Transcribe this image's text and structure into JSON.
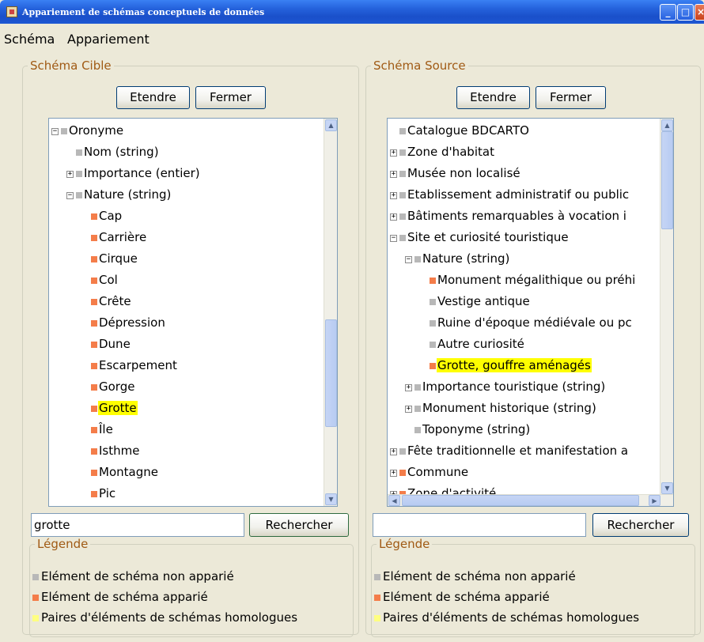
{
  "window": {
    "title": "Appariement de schémas conceptuels de données"
  },
  "menu": [
    "Schéma",
    "Appariement"
  ],
  "target": {
    "title": "Schéma Cible",
    "expand_label": "Etendre",
    "close_label": "Fermer",
    "tree": [
      {
        "label": "Oronyme",
        "square": "gray",
        "expander": "minus",
        "highlight": false
      },
      {
        "label": "Nom (string)",
        "square": "gray",
        "expander": null,
        "highlight": false
      },
      {
        "label": "Importance (entier)",
        "square": "gray",
        "expander": "plus",
        "highlight": false
      },
      {
        "label": "Nature (string)",
        "square": "gray",
        "expander": "minus",
        "highlight": false
      },
      {
        "label": "Cap",
        "square": "orange",
        "expander": null,
        "highlight": false
      },
      {
        "label": "Carrière",
        "square": "orange",
        "expander": null,
        "highlight": false
      },
      {
        "label": "Cirque",
        "square": "orange",
        "expander": null,
        "highlight": false
      },
      {
        "label": "Col",
        "square": "orange",
        "expander": null,
        "highlight": false
      },
      {
        "label": "Crête",
        "square": "orange",
        "expander": null,
        "highlight": false
      },
      {
        "label": "Dépression",
        "square": "orange",
        "expander": null,
        "highlight": false
      },
      {
        "label": "Dune",
        "square": "orange",
        "expander": null,
        "highlight": false
      },
      {
        "label": "Escarpement",
        "square": "orange",
        "expander": null,
        "highlight": false
      },
      {
        "label": "Gorge",
        "square": "orange",
        "expander": null,
        "highlight": false
      },
      {
        "label": "Grotte",
        "square": "orange",
        "expander": null,
        "highlight": true
      },
      {
        "label": "Île",
        "square": "orange",
        "expander": null,
        "highlight": false
      },
      {
        "label": "Isthme",
        "square": "orange",
        "expander": null,
        "highlight": false
      },
      {
        "label": "Montagne",
        "square": "orange",
        "expander": null,
        "highlight": false
      },
      {
        "label": "Pic",
        "square": "orange",
        "expander": null,
        "highlight": false
      }
    ],
    "search_value": "grotte",
    "search_button": "Rechercher"
  },
  "source": {
    "title": "Schéma Source",
    "expand_label": "Etendre",
    "close_label": "Fermer",
    "tree": [
      {
        "label": "Catalogue BDCARTO",
        "square": "gray",
        "expander": null,
        "highlight": false
      },
      {
        "label": "Zone d'habitat",
        "square": "gray",
        "expander": "plus",
        "highlight": false
      },
      {
        "label": "Musée non localisé",
        "square": "gray",
        "expander": "plus",
        "highlight": false
      },
      {
        "label": "Etablissement administratif ou public",
        "square": "gray",
        "expander": "plus",
        "highlight": false
      },
      {
        "label": "Bâtiments remarquables à vocation i",
        "square": "gray",
        "expander": "plus",
        "highlight": false
      },
      {
        "label": "Site et curiosité touristique",
        "square": "gray",
        "expander": "minus",
        "highlight": false
      },
      {
        "label": "Nature (string)",
        "square": "gray",
        "expander": "minus",
        "highlight": false
      },
      {
        "label": "Monument mégalithique ou préhi",
        "square": "orange",
        "expander": null,
        "highlight": false
      },
      {
        "label": "Vestige antique",
        "square": "gray",
        "expander": null,
        "highlight": false
      },
      {
        "label": "Ruine d'époque médiévale ou pc",
        "square": "gray",
        "expander": null,
        "highlight": false
      },
      {
        "label": "Autre curiosité",
        "square": "gray",
        "expander": null,
        "highlight": false
      },
      {
        "label": "Grotte, gouffre aménagés",
        "square": "orange",
        "expander": null,
        "highlight": true
      },
      {
        "label": "Importance touristique (string)",
        "square": "gray",
        "expander": "plus",
        "highlight": false
      },
      {
        "label": "Monument historique (string)",
        "square": "gray",
        "expander": "plus",
        "highlight": false
      },
      {
        "label": "Toponyme (string)",
        "square": "gray",
        "expander": null,
        "highlight": false
      },
      {
        "label": "Fête traditionnelle et manifestation a",
        "square": "gray",
        "expander": "plus",
        "highlight": false
      },
      {
        "label": "Commune",
        "square": "orange",
        "expander": "plus",
        "highlight": false
      },
      {
        "label": "Zone d'activité",
        "square": "orange",
        "expander": "plus",
        "highlight": false
      }
    ],
    "search_value": "",
    "search_button": "Rechercher"
  },
  "legend": {
    "title": "Légende",
    "items": [
      {
        "label": "Elément de schéma non apparié",
        "color": "#b8b8b8"
      },
      {
        "label": "Elément de schéma apparié",
        "color": "#f47d4a"
      },
      {
        "label": "Paires d'éléments de schémas homologues",
        "color": "#ffff80"
      }
    ]
  },
  "colors": {
    "highlight": "#ffff00",
    "matched": "#f47d4a",
    "unmatched": "#b8b8b8",
    "section_title": "#a05a14"
  }
}
